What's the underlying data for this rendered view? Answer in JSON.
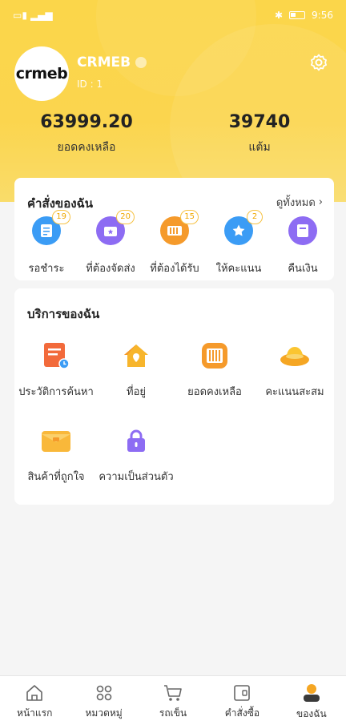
{
  "status_bar": {
    "time": "9:56"
  },
  "profile": {
    "logo_text": "crmeb",
    "name": "CRMEB",
    "id_text": "ID : 1"
  },
  "stats": [
    {
      "value": "63999.20",
      "label": "ยอดคงเหลือ"
    },
    {
      "value": "39740",
      "label": "แต้ม"
    }
  ],
  "orders": {
    "title": "คำสั่งของฉัน",
    "view_all": "ดูทั้งหมด",
    "items": [
      {
        "label": "รอชำระ",
        "badge": "19",
        "icon": "unpaid-icon",
        "color": "#3b9cf5"
      },
      {
        "label": "ที่ต้องจัดส่ง",
        "badge": "20",
        "icon": "to-ship-icon",
        "color": "#8d6cf3"
      },
      {
        "label": "ที่ต้องได้รับ",
        "badge": "15",
        "icon": "to-receive-icon",
        "color": "#f59a2b"
      },
      {
        "label": "ให้คะแนน",
        "badge": "2",
        "icon": "rate-icon",
        "color": "#3b9cf5"
      },
      {
        "label": "คืนเงิน",
        "badge": "",
        "icon": "refund-icon",
        "color": "#8d6cf3"
      }
    ]
  },
  "services": {
    "title": "บริการของฉัน",
    "items": [
      {
        "label": "ประวัติการค้นหา",
        "icon": "history-icon"
      },
      {
        "label": "ที่อยู่",
        "icon": "address-icon"
      },
      {
        "label": "ยอดคงเหลือ",
        "icon": "balance-icon"
      },
      {
        "label": "คะแนนสะสม",
        "icon": "points-icon"
      },
      {
        "label": "สินค้าที่ถูกใจ",
        "icon": "favorites-icon"
      },
      {
        "label": "ความเป็นส่วนตัว",
        "icon": "privacy-icon"
      }
    ]
  },
  "tabbar": [
    {
      "label": "หน้าแรก",
      "icon": "home-icon"
    },
    {
      "label": "หมวดหมู่",
      "icon": "category-icon"
    },
    {
      "label": "รถเข็น",
      "icon": "cart-icon"
    },
    {
      "label": "คำสั่งซื้อ",
      "icon": "orders-icon"
    },
    {
      "label": "ของฉัน",
      "icon": "me-icon",
      "active": true
    }
  ],
  "colors": {
    "accent": "#fbd64a",
    "badge": "#f6c244"
  }
}
